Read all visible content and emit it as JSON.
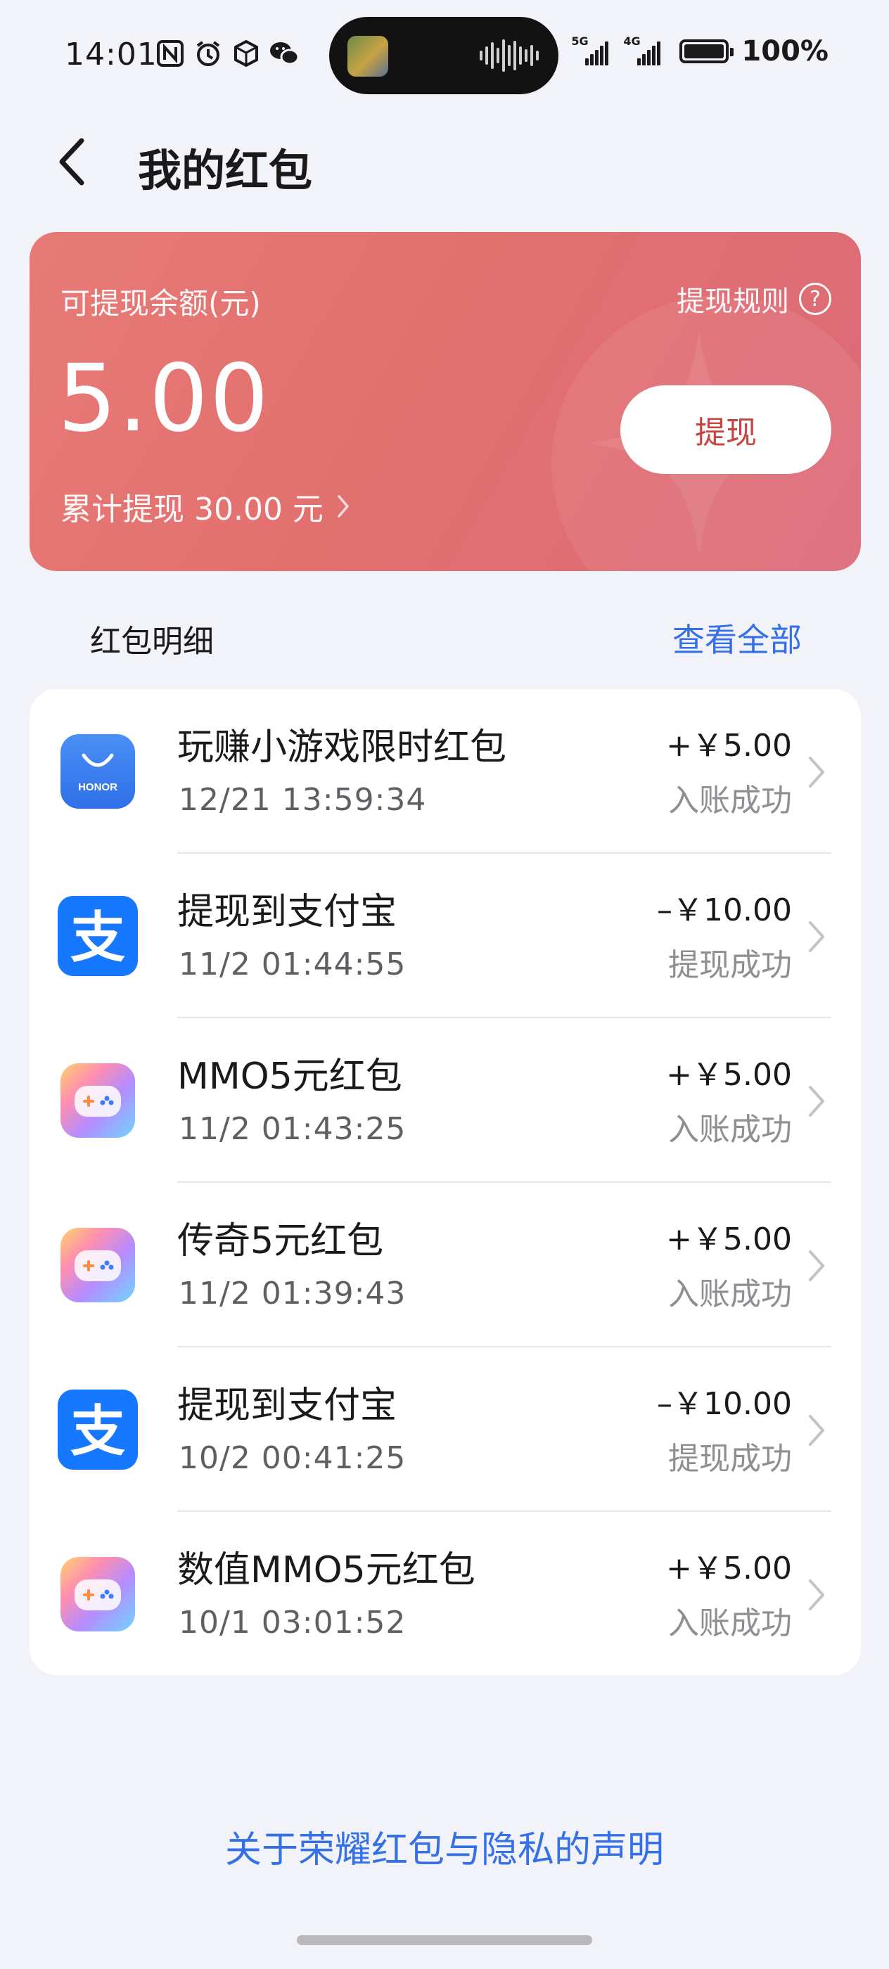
{
  "status_bar": {
    "time": "14:01",
    "battery": "100%",
    "signal_1_label": "5G",
    "signal_2_label": "4G",
    "left_icons": [
      "nfc-icon",
      "alarm-icon",
      "box-icon",
      "wechat-icon"
    ]
  },
  "header": {
    "title": "我的红包"
  },
  "balance_card": {
    "label": "可提现余额(元)",
    "rules_label": "提现规则",
    "amount": "5.00",
    "withdraw_button": "提现",
    "total_withdrawn": "累计提现 30.00 元",
    "colors": {
      "start": "#e77a76",
      "end": "#dc6a78",
      "button_text": "#c8433e"
    }
  },
  "details": {
    "title": "红包明细",
    "view_all": "查看全部",
    "items": [
      {
        "icon": "honor-app-icon",
        "title": "玩赚小游戏限时红包",
        "time": "12/21 13:59:34",
        "amount": "+￥5.00",
        "status": "入账成功"
      },
      {
        "icon": "alipay-icon",
        "title": "提现到支付宝",
        "time": "11/2 01:44:55",
        "amount": "–￥10.00",
        "status": "提现成功"
      },
      {
        "icon": "game-center-icon",
        "title": "MMO5元红包",
        "time": "11/2 01:43:25",
        "amount": "+￥5.00",
        "status": "入账成功"
      },
      {
        "icon": "game-center-icon",
        "title": "传奇5元红包",
        "time": "11/2 01:39:43",
        "amount": "+￥5.00",
        "status": "入账成功"
      },
      {
        "icon": "alipay-icon",
        "title": "提现到支付宝",
        "time": "10/2 00:41:25",
        "amount": "–￥10.00",
        "status": "提现成功"
      },
      {
        "icon": "game-center-icon",
        "title": "数值MMO5元红包",
        "time": "10/1 03:01:52",
        "amount": "+￥5.00",
        "status": "入账成功"
      }
    ]
  },
  "footer": {
    "privacy_link": "关于荣耀红包与隐私的声明"
  },
  "colors": {
    "background": "#f1f3f8",
    "link_blue": "#3670e6",
    "alipay_blue": "#1677ff"
  }
}
